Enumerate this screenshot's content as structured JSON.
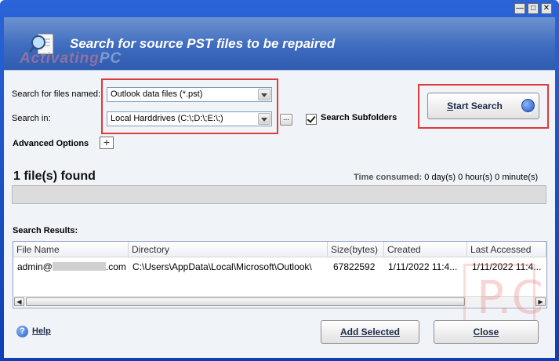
{
  "window": {
    "controls": [
      "—",
      "□",
      "✕"
    ]
  },
  "banner": {
    "title": "Search for source PST files to be repaired",
    "watermark_a": "Activating",
    "watermark_b": "PC"
  },
  "search": {
    "files_named_label": "Search for files named:",
    "files_named_value": "Outlook data files (*.pst)",
    "search_in_label": "Search in:",
    "search_in_value": "Local Harddrives (C:\\;D:\\;E:\\;)",
    "browse_label": "...",
    "subfolders_label": "Search Subfolders",
    "subfolders_checked": true,
    "advanced_label": "Advanced Options",
    "advanced_toggle": "+"
  },
  "start_button": {
    "label_prefix": "",
    "label_u": "S",
    "label_rest": "tart Search"
  },
  "status": {
    "found": "1 file(s) found",
    "time_label": "Time consumed:",
    "time_value": "0 day(s) 0 hour(s) 0 minute(s)",
    "progress_fraction": 0
  },
  "results": {
    "label": "Search Results:",
    "columns": [
      "File Name",
      "Directory",
      "Size(bytes)",
      "Created",
      "Last Accessed"
    ],
    "rows": [
      {
        "file_name_prefix": "admin@",
        "file_name_suffix": ".com",
        "directory": "C:\\Users\\AppData\\Local\\Microsoft\\Outlook\\",
        "size": "67822592",
        "created": "1/11/2022 11:4...",
        "last_accessed": "1/11/2022 11:4..."
      }
    ],
    "scroll_left": "◀",
    "scroll_right": "▶"
  },
  "footer": {
    "help_icon": "?",
    "help_label": "Help",
    "add_selected_label": "Add Selected",
    "close_label": "Close"
  },
  "watermark_pc": "P.C",
  "colors": {
    "title_bar": "#2a64d8",
    "banner": "#3f6cbf",
    "highlight_box": "#e03a3a",
    "accent_button": "#2459c9"
  }
}
